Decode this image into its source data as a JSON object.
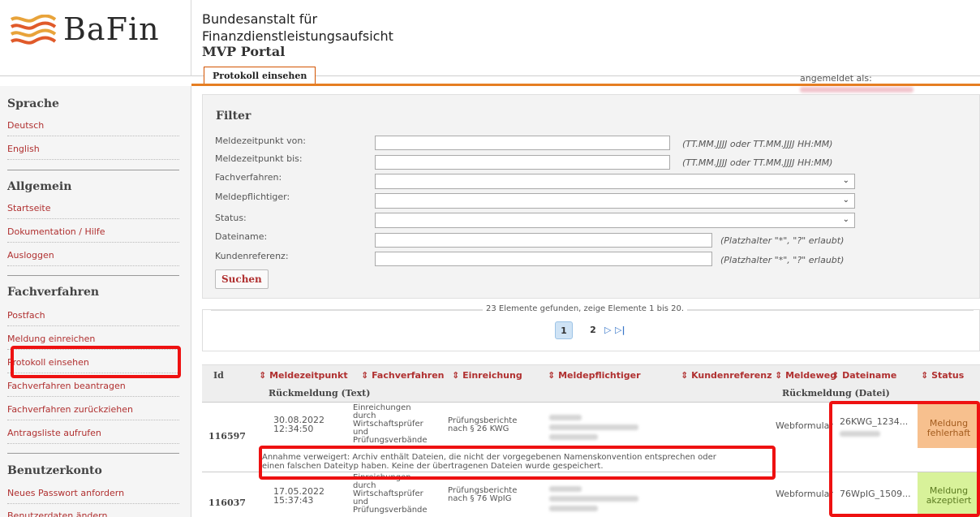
{
  "header": {
    "logo_text": "BaFin",
    "institution_line1": "Bundesanstalt für",
    "institution_line2": "Finanzdienstleistungsaufsicht",
    "portal_name": "MVP Portal",
    "active_tab": "Protokoll einsehen",
    "logged_in_label": "angemeldet als:"
  },
  "sidebar": {
    "sections": [
      {
        "heading": "Sprache",
        "items": [
          "Deutsch",
          "English"
        ]
      },
      {
        "heading": "Allgemein",
        "items": [
          "Startseite",
          "Dokumentation / Hilfe",
          "Ausloggen"
        ]
      },
      {
        "heading": "Fachverfahren",
        "items": [
          "Postfach",
          "Meldung einreichen",
          "Protokoll einsehen",
          "Fachverfahren beantragen",
          "Fachverfahren zurückziehen",
          "Antragsliste aufrufen"
        ]
      },
      {
        "heading": "Benutzerkonto",
        "items": [
          "Neues Passwort anfordern",
          "Benutzerdaten ändern"
        ]
      }
    ],
    "highlighted_item": "Protokoll einsehen"
  },
  "filter": {
    "title": "Filter",
    "fields": [
      {
        "label": "Meldezeitpunkt von:",
        "value": "",
        "hint": "(TT.MM.JJJJ oder TT.MM.JJJJ HH:MM)"
      },
      {
        "label": "Meldezeitpunkt bis:",
        "value": "",
        "hint": "(TT.MM.JJJJ oder TT.MM.JJJJ HH:MM)"
      },
      {
        "label": "Fachverfahren:",
        "value": ""
      },
      {
        "label": "Meldepflichtiger:",
        "value": ""
      },
      {
        "label": "Status:",
        "value": ""
      },
      {
        "label": "Dateiname:",
        "value": "",
        "hint": "(Platzhalter \"*\", \"?\" erlaubt)"
      },
      {
        "label": "Kundenreferenz:",
        "value": "",
        "hint": "(Platzhalter \"*\", \"?\" erlaubt)"
      }
    ],
    "search_button": "Suchen"
  },
  "pagination": {
    "summary": "23 Elemente gefunden, zeige Elemente 1 bis 20.",
    "pages": [
      "1",
      "2"
    ],
    "current_page": "1",
    "next_icon": "next-page-icon",
    "last_icon": "last-page-icon"
  },
  "table": {
    "headers": {
      "id": "Id",
      "meldezeitpunkt": "Meldezeitpunkt",
      "fachverfahren": "Fachverfahren",
      "einreichung": "Einreichung",
      "meldepflichtiger": "Meldepflichtiger",
      "kundenreferenz": "Kundenreferenz",
      "meldeweg": "Meldeweg",
      "dateiname": "Dateiname",
      "status": "Status",
      "rueckmeldung_text": "Rückmeldung (Text)",
      "rueckmeldung_datei": "Rückmeldung (Datei)"
    },
    "sort_icon": "⇕",
    "rows": [
      {
        "id": "116597",
        "date": "30.08.2022",
        "time": "12:34:50",
        "fachverfahren_lines": [
          "Einreichungen",
          "durch",
          "Wirtschaftsprüfer",
          "und",
          "Prüfungsverbände"
        ],
        "einreichung_lines": [
          "Prüfungsberichte",
          "nach § 26 KWG"
        ],
        "meldeweg": "Webformular",
        "dateiname": "26KWG_1234...",
        "status_lines": [
          "Meldung",
          "fehlerhaft"
        ],
        "message_lines": [
          "Annahme verweigert: Archiv enthält Dateien, die nicht der vorgegebenen Namenskonvention entsprechen oder",
          "einen falschen Dateityp haben. Keine der übertragenen Dateien wurde gespeichert."
        ]
      },
      {
        "id": "116037",
        "date": "17.05.2022",
        "time": "15:37:43",
        "fachverfahren_lines": [
          "Einreichungen",
          "durch",
          "Wirtschaftsprüfer",
          "und",
          "Prüfungsverbände"
        ],
        "einreichung_lines": [
          "Prüfungsberichte",
          "nach § 76 WpIG"
        ],
        "meldeweg": "Webformular",
        "dateiname": "76WpIG_1509...",
        "status_lines": [
          "Meldung",
          "akzeptiert"
        ]
      }
    ]
  },
  "colors": {
    "accent_orange": "#e67e22",
    "link_red": "#b03030",
    "status_error_bg": "#f7c08e",
    "status_ok_bg": "#d8f29a",
    "highlight_red": "#ee1111"
  }
}
